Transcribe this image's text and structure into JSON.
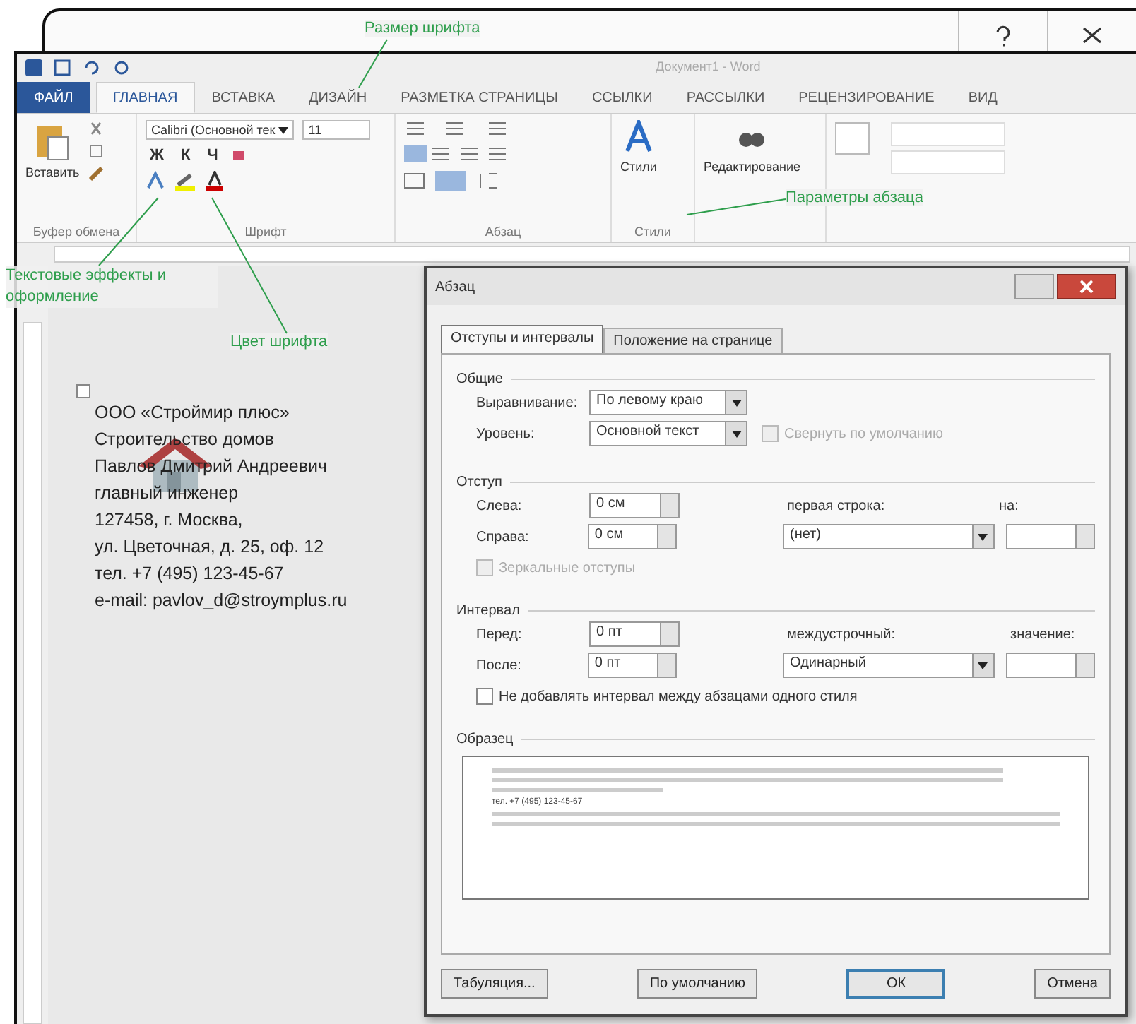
{
  "window": {
    "title": "Документ1 - Word"
  },
  "tabs": [
    {
      "label": "ФАЙЛ",
      "kind": "file",
      "selected": false
    },
    {
      "label": "ГЛАВНАЯ",
      "kind": "tab",
      "selected": true
    },
    {
      "label": "ВСТАВКА",
      "kind": "tab",
      "selected": false
    },
    {
      "label": "ДИЗАЙН",
      "kind": "tab",
      "selected": false
    },
    {
      "label": "РАЗМЕТКА СТРАНИЦЫ",
      "kind": "tab",
      "selected": false
    },
    {
      "label": "ССЫЛКИ",
      "kind": "tab",
      "selected": false
    },
    {
      "label": "РАССЫЛКИ",
      "kind": "tab",
      "selected": false
    },
    {
      "label": "РЕЦЕНЗИРОВАНИЕ",
      "kind": "tab",
      "selected": false
    },
    {
      "label": "ВИД",
      "kind": "tab",
      "selected": false
    }
  ],
  "ribbon": {
    "paste_label": "Вставить",
    "font_name": "Calibri (Основной тек",
    "font_size": "11",
    "format_buttons": [
      "Ж",
      "К",
      "Ч"
    ],
    "styles_label": "Стили",
    "editing_label": "Редактирование",
    "groups": [
      "Буфер обмена",
      "Шрифт",
      "Абзац",
      "Стили"
    ]
  },
  "annotations": [
    "Размер шрифта",
    "Параметры абзаца",
    "Текстовые эффекты и оформление",
    "Цвет шрифта"
  ],
  "document": {
    "lines": [
      "ООО «Строймир плюс»",
      "Строительство домов",
      "Павлов Дмитрий Андреевич",
      "главный инженер",
      "127458, г. Москва,",
      "ул. Цветочная, д. 25, оф. 12",
      "тел. +7 (495) 123-45-67",
      "e-mail: pavlov_d@stroymplus.ru"
    ]
  },
  "dialog": {
    "title": "Абзац",
    "tabs": [
      {
        "label": "Отступы и интервалы",
        "selected": true
      },
      {
        "label": "Положение на странице",
        "selected": false
      }
    ],
    "general": {
      "heading": "Общие",
      "alignment_label": "Выравнивание:",
      "alignment": "По левому краю",
      "level_label": "Уровень:",
      "level": "Основной текст",
      "collapse": {
        "label": "Свернуть по умолчанию",
        "checked": false,
        "disabled": true
      }
    },
    "indent": {
      "heading": "Отступ",
      "left_label": "Слева:",
      "left": "0 см",
      "right_label": "Справа:",
      "right": "0 см",
      "first_line_label": "первая строка:",
      "first_line": "(нет)",
      "by_label": "на:",
      "mirror": {
        "label": "Зеркальные отступы",
        "checked": false,
        "disabled": true
      }
    },
    "spacing": {
      "heading": "Интервал",
      "before_label": "Перед:",
      "before": "0 пт",
      "after_label": "После:",
      "after": "0 пт",
      "line_label": "междустрочный:",
      "line": "Одинарный",
      "value_label": "значение:",
      "no_space": {
        "label": "Не добавлять интервал между абзацами одного стиля",
        "checked": false,
        "disabled": false
      }
    },
    "preview": {
      "heading": "Образец",
      "sample": "тел. +7 (495) 123-45-67"
    },
    "buttons": [
      {
        "label": "Табуляция...",
        "kind": "normal"
      },
      {
        "label": "По умолчанию",
        "kind": "normal"
      },
      {
        "label": "ОК",
        "kind": "default"
      },
      {
        "label": "Отмена",
        "kind": "normal"
      }
    ]
  }
}
